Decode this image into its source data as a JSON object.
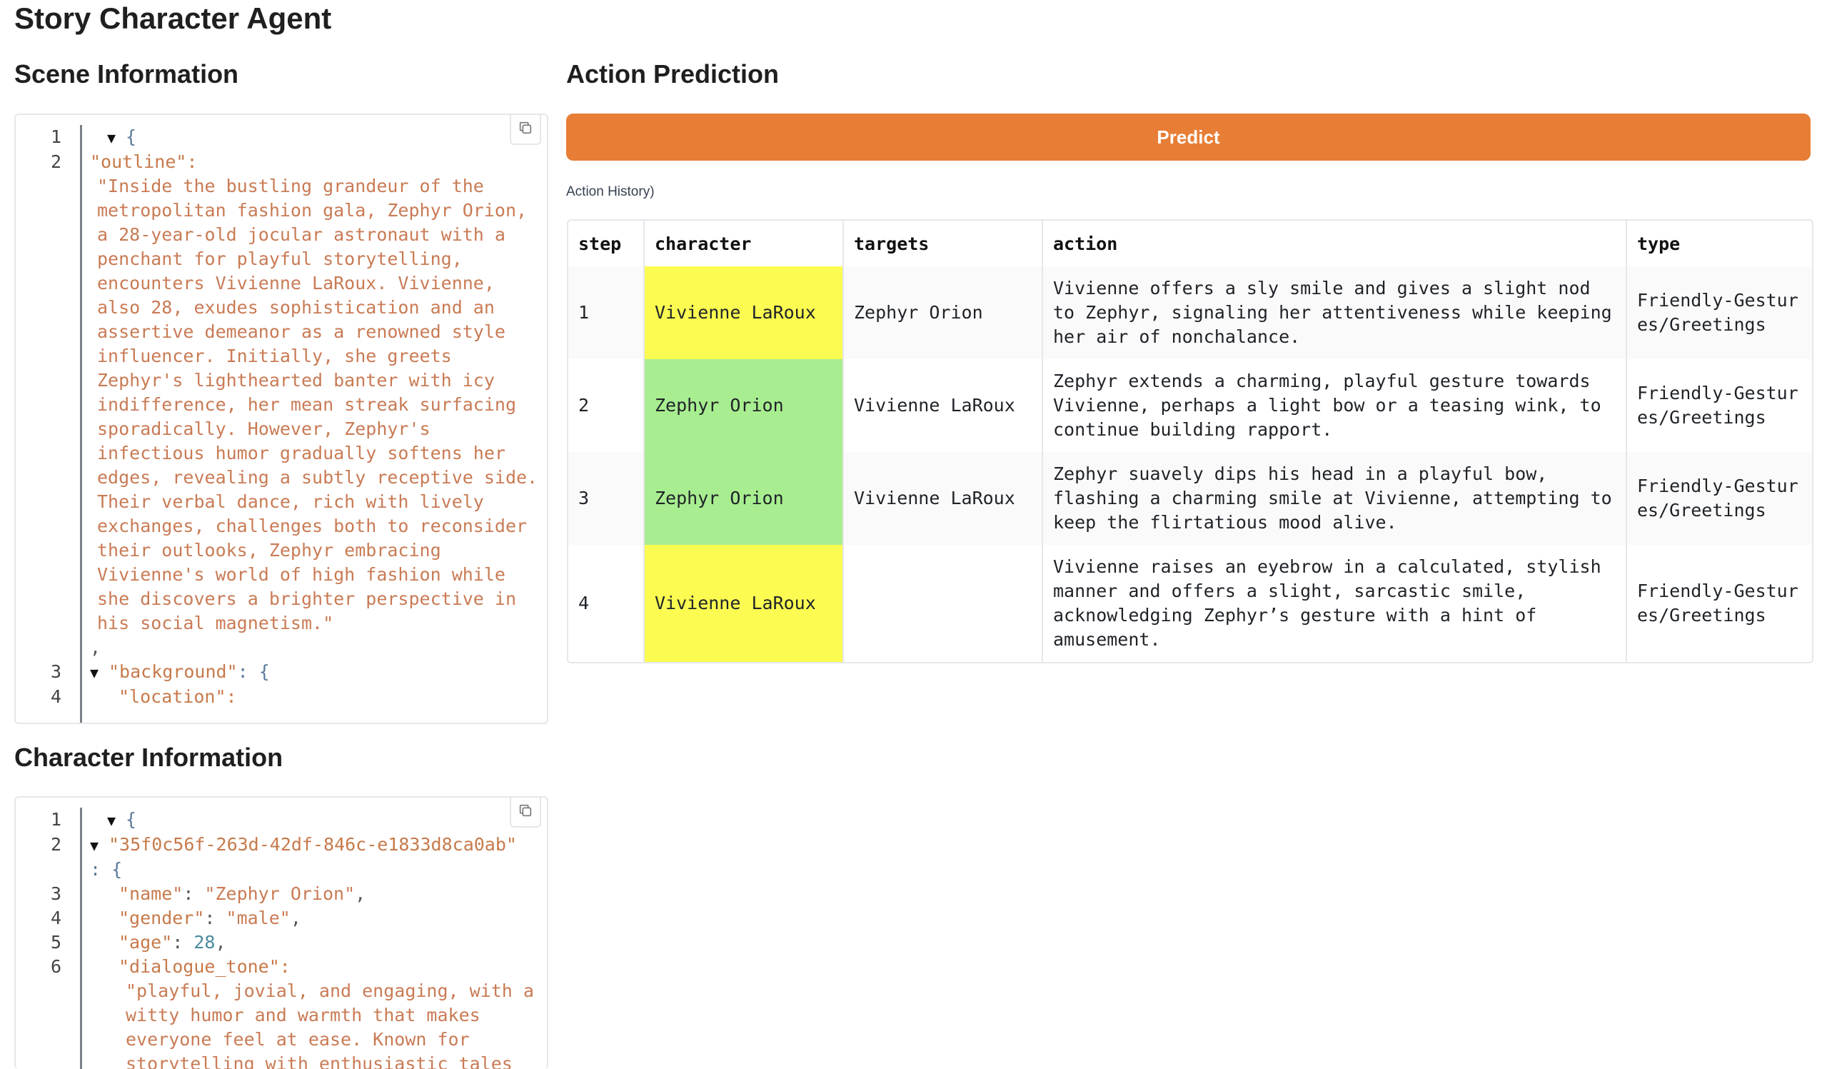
{
  "app": {
    "title": "Story Character Agent"
  },
  "scene": {
    "heading": "Scene Information",
    "lines": [
      {
        "num": "1",
        "type": "open",
        "text": "{"
      },
      {
        "num": "2",
        "type": "key",
        "text": "\"outline\":"
      },
      {
        "num": "",
        "type": "str",
        "text": "\"Inside the bustling grandeur of the metropolitan fashion gala, Zephyr Orion, a 28-year-old jocular astronaut with a penchant for playful storytelling, encounters Vivienne LaRoux. Vivienne, also 28, exudes sophistication and an assertive demeanor as a renowned style influencer. Initially, she greets Zephyr's lighthearted banter with icy indifference, her mean streak surfacing sporadically. However, Zephyr's infectious humor gradually softens her edges, revealing a subtly receptive side. Their verbal dance, rich with lively exchanges, challenges both to reconsider their outlooks, Zephyr embracing Vivienne's world of high fashion while she discovers a brighter perspective in his social magnetism.\""
      },
      {
        "num": "",
        "type": "comma",
        "text": ","
      },
      {
        "num": "3",
        "type": "keyopen",
        "text": "\"background\"",
        "suffix": ": {"
      },
      {
        "num": "4",
        "type": "key",
        "text": "\"location\":"
      }
    ]
  },
  "character": {
    "heading": "Character Information",
    "id_key": "\"35f0c56f-263d-42df-846c-e1833d8ca0ab\"",
    "id_suffix": ": {",
    "name_key": "\"name\"",
    "name_val": "\"Zephyr Orion\"",
    "gender_key": "\"gender\"",
    "gender_val": "\"male\"",
    "age_key": "\"age\"",
    "age_val": "28",
    "tone_key": "\"dialogue_tone\":",
    "tone_val": "\"playful, jovial, and engaging, with a witty humor and warmth that makes everyone feel at ease. Known for storytelling with enthusiastic tales",
    "line_nums": [
      "1",
      "2",
      "3",
      "4",
      "5",
      "6"
    ]
  },
  "prediction": {
    "heading": "Action Prediction",
    "predict_label": "Predict",
    "history_label": "Action History)",
    "columns": [
      "step",
      "character",
      "targets",
      "action",
      "type"
    ],
    "rows": [
      {
        "step": "1",
        "character": "Vivienne LaRoux",
        "targets": "Zephyr Orion",
        "action": "Vivienne offers a sly smile and gives a slight nod to Zephyr, signaling her attentiveness while keeping her air of nonchalance.",
        "type": "Friendly-Gestures/Greetings",
        "color": "#fbfb51"
      },
      {
        "step": "2",
        "character": "Zephyr Orion",
        "targets": "Vivienne LaRoux",
        "action": "Zephyr extends a charming, playful gesture towards Vivienne, perhaps a light bow or a teasing wink, to continue building rapport.",
        "type": "Friendly-Gestures/Greetings",
        "color": "#a8ee90"
      },
      {
        "step": "3",
        "character": "Zephyr Orion",
        "targets": "Vivienne LaRoux",
        "action": "Zephyr suavely dips his head in a playful bow, flashing a charming smile at Vivienne, attempting to keep the flirtatious mood alive.",
        "type": "Friendly-Gestures/Greetings",
        "color": "#a8ee90"
      },
      {
        "step": "4",
        "character": "Vivienne LaRoux",
        "targets": "",
        "action": "Vivienne raises an eyebrow in a calculated, stylish manner and offers a slight, sarcastic smile, acknowledging Zephyr’s gesture with a hint of amusement.",
        "type": "Friendly-Gestures/Greetings",
        "color": "#fbfb51"
      }
    ]
  },
  "icons": {
    "copy": "copy-icon",
    "collapse": "triangle-down-icon"
  },
  "colors": {
    "accent": "#e87d35",
    "string": "#c97b55",
    "number": "#4b8b9e"
  }
}
